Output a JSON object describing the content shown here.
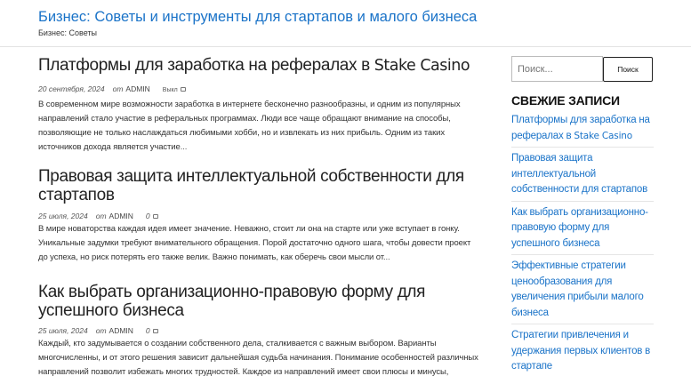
{
  "header": {
    "site_title": "Бизнес: Советы и инструменты для стартапов и малого бизнеса",
    "tagline": "Бизнес: Советы"
  },
  "posts": [
    {
      "title": "Платформы для заработка на рефералах в",
      "title_suffix": "Stake Casino",
      "date": "20 сентября, 2024",
      "by": "от",
      "author": "ADMIN",
      "comments": "",
      "extra": "Выкл",
      "excerpt": "В современном мире возможности заработка в интернете бесконечно разнообразны, и одним из популярных направлений стало участие в реферальных программах. Люди все чаще обращают внимание на способы, позволяющие не только наслаждаться любимыми хобби, но и извлекать из них прибыль. Одним из таких источников дохода является участие",
      "more": "..."
    },
    {
      "title": "Правовая защита интеллектуальной собственности для стартапов",
      "date": "25 июля, 2024",
      "by": "от",
      "author": "ADMIN",
      "comments": "0",
      "excerpt": "В мире новаторства каждая идея имеет значение. Неважно, стоит ли она на старте или уже вступает в гонку. Уникальные задумки требуют внимательного обращения. Порой достаточно одного шага, чтобы довести проект до успеха, но риск потерять его также велик. Важно понимать, как оберечь свои мысли от",
      "more": "..."
    },
    {
      "title": "Как выбрать организационно-правовую форму для успешного бизнеса",
      "date": "25 июля, 2024",
      "by": "от",
      "author": "ADMIN",
      "comments": "0",
      "excerpt": "Каждый, кто задумывается о создании собственного дела, сталкивается с важным выбором. Варианты многочисленны, и от этого решения зависит дальнейшая судьба начинания. Понимание особенностей различных направлений позволит избежать многих трудностей. Каждое из направлений имеет свои плюсы и минусы, которые"
    }
  ],
  "sidebar": {
    "search_placeholder": "Поиск...",
    "search_button": "Поиск",
    "widget_title": "СВЕЖИЕ ЗАПИСИ",
    "recent": [
      {
        "text": "Платформы для заработка на рефералах в",
        "suffix": "Stake Casino"
      },
      {
        "text": "Правовая защита интеллектуальной собственности для стартапов"
      },
      {
        "text": "Как выбрать организационно-правовую форму для успешного бизнеса"
      },
      {
        "text": "Эффективные стратегии ценообразования для увеличения прибыли малого бизнеса"
      },
      {
        "text": "Стратегии привлечения и удержания первых клиентов в стартапе"
      }
    ]
  },
  "colors": {
    "link": "#1a73c8",
    "text": "#222222",
    "border": "#e3e3e3"
  },
  "icons": {
    "comment": "comment-icon"
  }
}
